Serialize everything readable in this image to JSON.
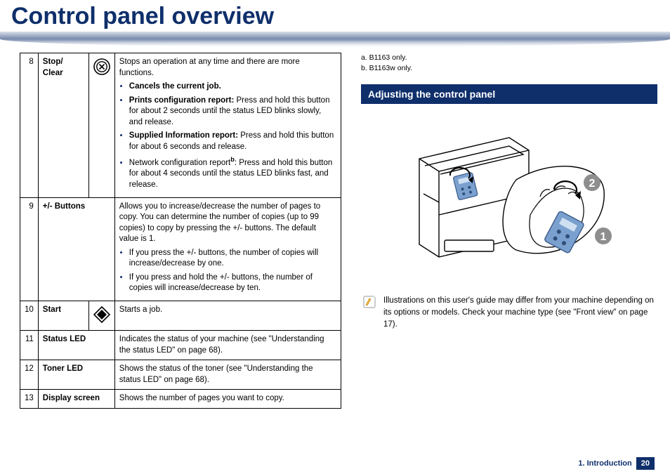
{
  "title": "Control panel overview",
  "table": {
    "rows": [
      {
        "num": "8",
        "name": "Stop/\nClear",
        "icon": "stop-clear",
        "desc_lead": "Stops an operation at any time and there are more functions.",
        "bullets": [
          {
            "strong": "Cancels the current job.",
            "rest": ""
          },
          {
            "strong": "Prints configuration report:",
            "rest": " Press and hold this button for about 2 seconds until the status LED blinks slowly, and release."
          },
          {
            "strong": "Supplied Information report:",
            "rest": " Press and hold this button for about 6 seconds and release."
          },
          {
            "strong": "",
            "rest": "Network configuration report",
            "sup": "b",
            "tail": ": Press and hold this button for about 4 seconds until the status LED blinks fast, and release."
          }
        ]
      },
      {
        "num": "9",
        "name": "+/- Buttons",
        "desc_lead": "Allows you to increase/decrease the number of pages to copy. You can determine the number of copies (up to 99 copies) to copy by pressing the +/- buttons. The default value is 1.",
        "bullets": [
          {
            "strong": "",
            "rest": "If you press the +/- buttons, the number of copies will increase/decrease by one."
          },
          {
            "strong": "",
            "rest": "If you press and hold the +/- buttons, the number of copies will increase/decrease by ten."
          }
        ]
      },
      {
        "num": "10",
        "name": "Start",
        "icon": "start",
        "desc_lead": "Starts a job."
      },
      {
        "num": "11",
        "name": "Status LED",
        "desc_lead": "Indicates the status of your machine (see \"Understanding the status LED\" on page 68)."
      },
      {
        "num": "12",
        "name": "Toner LED",
        "desc_lead": "Shows the status of the toner (see \"Understanding the status LED\" on page 68)."
      },
      {
        "num": "13",
        "name": "Display screen",
        "desc_lead": "Shows the number of pages you want to copy."
      }
    ]
  },
  "footnotes": {
    "a": "a.  B1163 only.",
    "b": "b.  B1163w only."
  },
  "section_heading": "Adjusting the control panel",
  "illustration": {
    "callout1": "1",
    "callout2": "2"
  },
  "note": "Illustrations on this user's guide may differ from your machine depending on its options or models. Check your machine type (see \"Front view\" on page 17).",
  "footer": {
    "chapter": "1.  Introduction",
    "page": "20"
  }
}
